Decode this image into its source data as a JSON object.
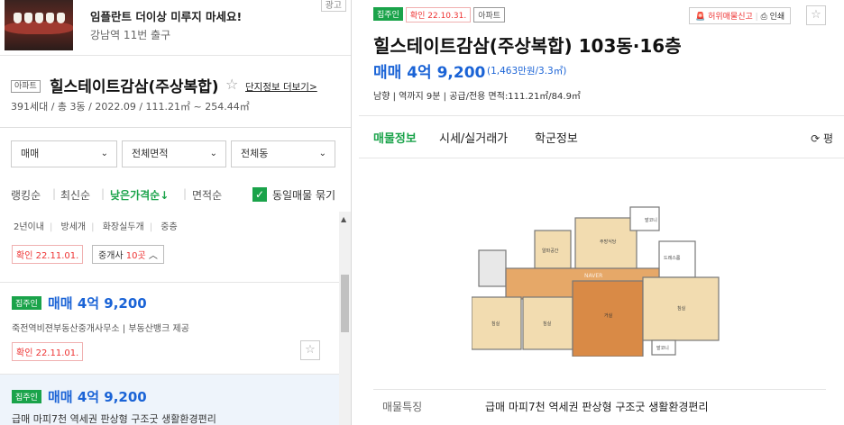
{
  "ad": {
    "title": "임플란트 더이상 미루지 마세요!",
    "sub": "강남역 11번 출구",
    "close": "광고"
  },
  "complex": {
    "type_tag": "아파트",
    "name": "힐스테이트감삼(주상복합)",
    "star": "☆",
    "detail_link": "단지정보 더보기>",
    "info": "391세대 / 총 3동 / 2022.09 / 111.21㎡ ~ 254.44㎡"
  },
  "filters": {
    "trade": "매매",
    "area": "전체면적",
    "dong": "전체동"
  },
  "sort": {
    "items": [
      "랭킹순",
      "최신순",
      "낮은가격순↓",
      "면적순"
    ],
    "checkbox_label": "동일매물 묶기",
    "checked": true
  },
  "listing_group": {
    "tags": [
      "2년이내",
      "방세개",
      "화장실두개",
      "중층"
    ],
    "confirm": "확인 22.11.01.",
    "agents_prefix": "중개사 ",
    "agents_count": "10곳",
    "agents_suffix": " ︿"
  },
  "items": [
    {
      "badge": "집주인",
      "price": "매매 4억 9,200",
      "agent": "죽전역비젼부동산중개사무소 | 부동산뱅크 제공",
      "confirm": "확인 22.11.01."
    },
    {
      "badge": "집주인",
      "price": "매매 4억 9,200",
      "desc": "급매 마피7천 역세권 판상형 구조굿 생활환경편리"
    }
  ],
  "detail": {
    "tags": [
      "집주인",
      "확인 22.10.31.",
      "아파트"
    ],
    "report": "허위매물신고",
    "print": "인쇄",
    "title": "힐스테이트감삼(주상복합) 103동·16층",
    "price": "매매 4억 9,200",
    "price_sub": "(1,463만원/3.3㎡)",
    "info": "남향 | 역까지 9분 | 공급/전용 면적:111.21㎡/84.9㎡",
    "tabs": [
      "매물정보",
      "시세/실거래가",
      "학군정보"
    ],
    "tab_refresh": "⟳ 평",
    "feature_label": "매물특징",
    "feature_value": "급매 마피7천 역세권 판상형 구조굿 생활환경편리",
    "floorplan_labels": {
      "balcony1": "발코니",
      "balcony2": "발코니",
      "dress": "드레스룸",
      "room1": "침실",
      "room2": "침실",
      "room3": "침실",
      "living": "거실",
      "kitchen": "주방식당",
      "study": "알파공간",
      "watermark": "NAVER"
    }
  },
  "colors": {
    "green": "#1aa34a",
    "blue": "#1a63d6",
    "red": "#e33333"
  }
}
